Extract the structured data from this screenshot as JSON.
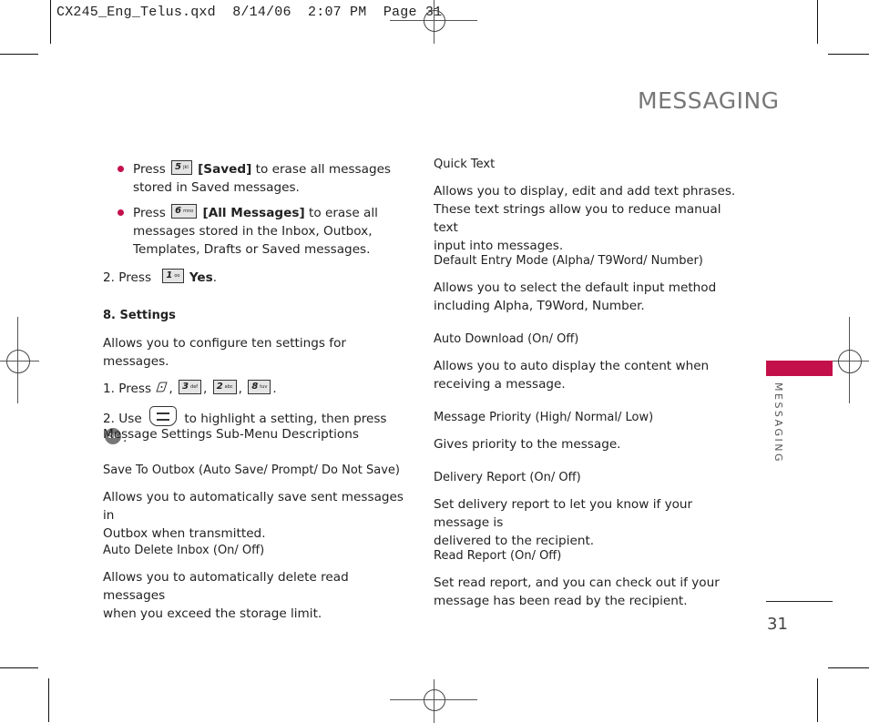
{
  "slug": "CX245_Eng_Telus.qxd  8/14/06  2:07 PM  Page 31",
  "header": {
    "title": "MESSAGING",
    "side_tab_label": "MESSAGING",
    "accent_color": "#c4104a",
    "page_number": "31"
  },
  "left_column": {
    "bullets": [
      {
        "press": "Press",
        "key": {
          "digit": "5",
          "letters": "jkl"
        },
        "option": "[Saved]",
        "text_line1": " to erase all messages",
        "text_line2": "stored in Saved messages."
      },
      {
        "press": "Press",
        "key": {
          "digit": "6",
          "letters": "mno"
        },
        "option": "[All Messages]",
        "text_line1": " to erase all",
        "text_line2": "messages stored in the Inbox, Outbox,",
        "text_line3": "Templates, Drafts or Saved messages."
      }
    ],
    "step2": {
      "prefix": "2. Press",
      "key": {
        "digit": "1",
        "letters": "oo"
      },
      "option": "Yes",
      "suffix": "."
    },
    "section8": {
      "heading": "8. Settings",
      "desc": "Allows you to configure ten settings for messages.",
      "step1": {
        "prefix": "1. Press",
        "keys": [
          {
            "digit": "3",
            "letters": "def"
          },
          {
            "digit": "2",
            "letters": "abc"
          },
          {
            "digit": "8",
            "letters": "tuv"
          }
        ],
        "separator": ",",
        "suffix": "."
      },
      "step2": {
        "prefix": "2. Use",
        "middle": "to highlight a setting, then press",
        "ok_label": "OK",
        "suffix": "."
      }
    },
    "submenu_heading": "Message Settings Sub-Menu Descriptions",
    "items": [
      {
        "title": "Save To Outbox (Auto Save/ Prompt/ Do Not Save)",
        "lines": [
          "Allows you to automatically save sent messages in",
          "Outbox when transmitted."
        ]
      },
      {
        "title": "Auto Delete Inbox (On/ Off)",
        "lines": [
          "Allows you to automatically delete read messages",
          "when you exceed the storage limit."
        ]
      }
    ]
  },
  "right_column": {
    "items": [
      {
        "title": "Quick Text",
        "lines": [
          "Allows you to display, edit and add text phrases.",
          "These text strings allow you to reduce manual text",
          "input into messages."
        ]
      },
      {
        "title": "Default Entry Mode (Alpha/ T9Word/ Number)",
        "lines": [
          "Allows you to select the default input method",
          "including Alpha, T9Word, Number."
        ]
      },
      {
        "title": "Auto Download (On/ Off)",
        "lines": [
          "Allows you to auto display the content when",
          "receiving a message."
        ]
      },
      {
        "title": "Message Priority (High/ Normal/ Low)",
        "lines": [
          "Gives priority to the message."
        ]
      },
      {
        "title": "Delivery Report (On/ Off)",
        "lines": [
          "Set delivery report to let you know if your message is",
          "delivered to the recipient."
        ]
      },
      {
        "title": "Read Report (On/ Off)",
        "lines": [
          "Set read report, and you can check out if your",
          "message has been read by the recipient."
        ]
      }
    ]
  }
}
